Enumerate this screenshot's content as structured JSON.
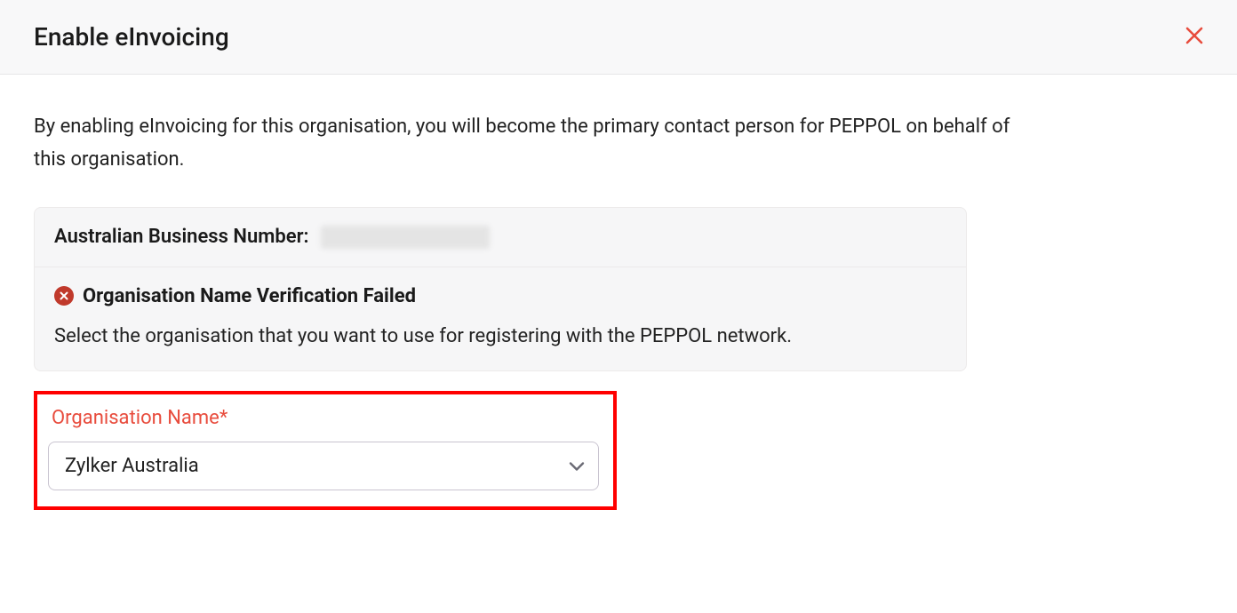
{
  "header": {
    "title": "Enable eInvoicing"
  },
  "intro": "By enabling eInvoicing for this organisation, you will become the primary contact person for PEPPOL on behalf of this organisation.",
  "panel": {
    "abn_label": "Australian Business Number:",
    "error_title": "Organisation Name Verification Failed",
    "error_desc": "Select the organisation that you want to use for registering with the PEPPOL network."
  },
  "form": {
    "org_label": "Organisation Name*",
    "org_value": "Zylker Australia"
  }
}
